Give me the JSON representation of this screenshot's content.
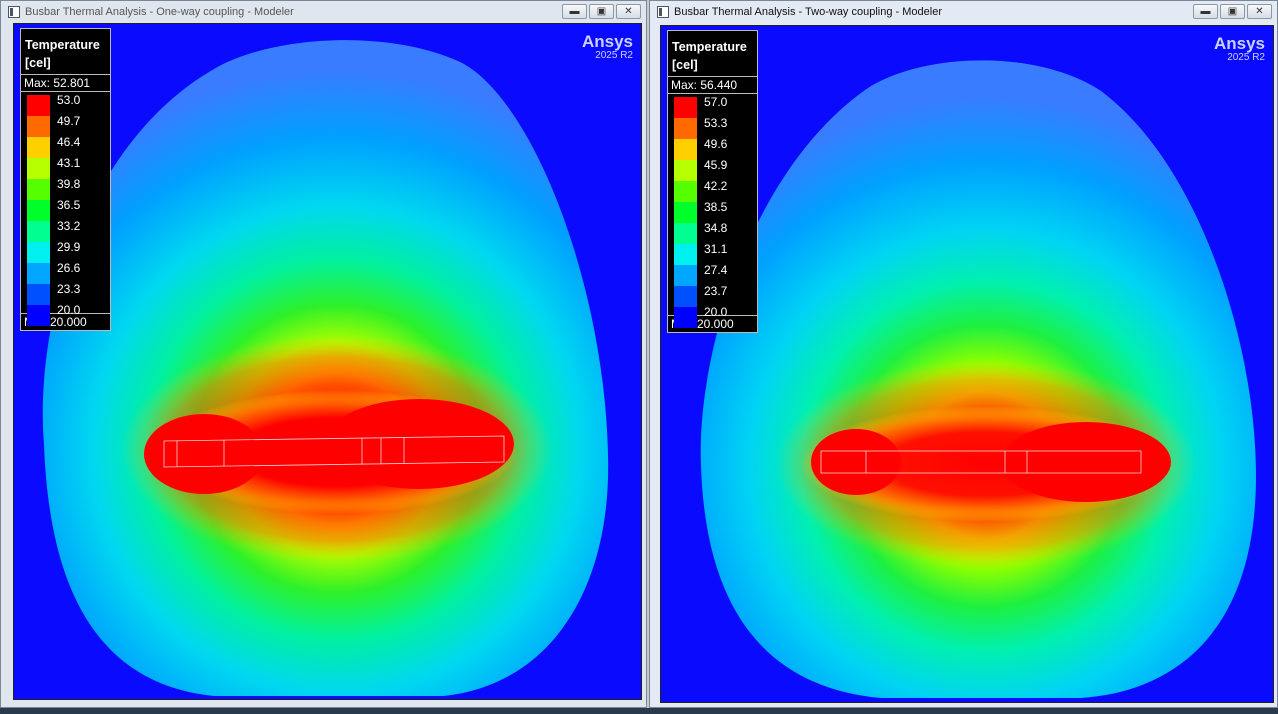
{
  "windows": [
    {
      "id": "one-way",
      "title": "Busbar Thermal Analysis - One-way coupling - Modeler",
      "controls": {
        "minimize": "▬",
        "restore": "▣",
        "close": "✕"
      },
      "brand": {
        "name": "Ansys",
        "version": "2025 R2"
      },
      "legend": {
        "title_line1": "Temperature",
        "title_line2": "[cel]",
        "max_text": "Max: 52.801",
        "min_text": "Min: 20.000",
        "values": [
          "53.0",
          "49.7",
          "46.4",
          "43.1",
          "39.8",
          "36.5",
          "33.2",
          "29.9",
          "26.6",
          "23.3",
          "20.0"
        ],
        "colors": [
          "#ff0000",
          "#ff6a00",
          "#ffd000",
          "#b5ff00",
          "#55ff00",
          "#00ff2a",
          "#00ff90",
          "#00f0f0",
          "#00a6ff",
          "#0050ff",
          "#0000ff"
        ]
      }
    },
    {
      "id": "two-way",
      "title": "Busbar Thermal Analysis - Two-way coupling - Modeler",
      "controls": {
        "minimize": "▬",
        "restore": "▣",
        "close": "✕"
      },
      "brand": {
        "name": "Ansys",
        "version": "2025 R2"
      },
      "legend": {
        "title_line1": "Temperature",
        "title_line2": "[cel]",
        "max_text": "Max: 56.440",
        "min_text": "Min: 20.000",
        "values": [
          "57.0",
          "53.3",
          "49.6",
          "45.9",
          "42.2",
          "38.5",
          "34.8",
          "31.1",
          "27.4",
          "23.7",
          "20.0"
        ],
        "colors": [
          "#ff0000",
          "#ff6a00",
          "#ffd000",
          "#b5ff00",
          "#55ff00",
          "#00ff2a",
          "#00ff90",
          "#00f0f0",
          "#00a6ff",
          "#0050ff",
          "#0000ff"
        ]
      }
    }
  ]
}
